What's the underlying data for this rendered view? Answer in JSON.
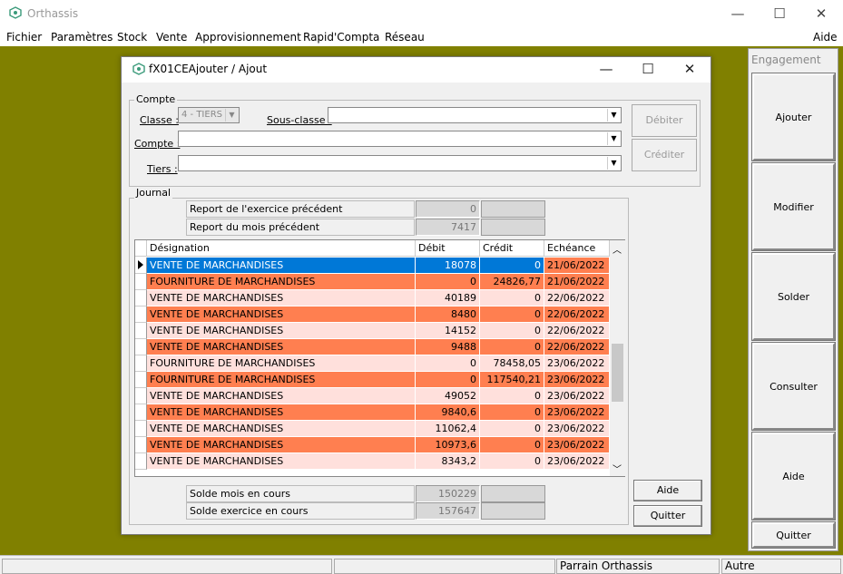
{
  "app": {
    "title": "Orthassis",
    "minimize": "—",
    "maximize": "☐",
    "close": "✕"
  },
  "menu": [
    "Fichier",
    "Paramètres",
    "Stock",
    "Vente",
    "Approvisionnement",
    "Rapid'Compta",
    "Réseau"
  ],
  "menu_help": "Aide",
  "engagement": {
    "title": "Engagement",
    "buttons": [
      "Ajouter",
      "Modifier",
      "Solder",
      "Consulter",
      "Aide",
      "Quitter"
    ]
  },
  "dialog": {
    "title": "fX01CEAjouter / Ajout",
    "compte": {
      "group": "Compte",
      "classe_label": "Classe :",
      "classe_value": "4 - TIERS",
      "sousclasse_label": "Sous-classe :",
      "compte_label": "Compte :",
      "tiers_label": "Tiers :",
      "debiter": "Débiter",
      "crediter": "Créditer"
    },
    "journal": {
      "group": "Journal",
      "report_exercice_label": "Report de l'exercice précédent",
      "report_exercice_value": "0",
      "report_mois_label": "Report du mois précédent",
      "report_mois_value": "7417",
      "columns": [
        "Désignation",
        "Débit",
        "Crédit",
        "Echéance"
      ],
      "rows": [
        [
          "VENTE DE MARCHANDISES",
          "18078",
          "0",
          "21/06/2022"
        ],
        [
          "FOURNITURE DE MARCHANDISES",
          "0",
          "24826,77",
          "21/06/2022"
        ],
        [
          "VENTE DE MARCHANDISES",
          "40189",
          "0",
          "22/06/2022"
        ],
        [
          "VENTE DE MARCHANDISES",
          "8480",
          "0",
          "22/06/2022"
        ],
        [
          "VENTE DE MARCHANDISES",
          "14152",
          "0",
          "22/06/2022"
        ],
        [
          "VENTE DE MARCHANDISES",
          "9488",
          "0",
          "22/06/2022"
        ],
        [
          "FOURNITURE DE MARCHANDISES",
          "0",
          "78458,05",
          "23/06/2022"
        ],
        [
          "FOURNITURE DE MARCHANDISES",
          "0",
          "117540,21",
          "23/06/2022"
        ],
        [
          "VENTE DE MARCHANDISES",
          "49052",
          "0",
          "23/06/2022"
        ],
        [
          "VENTE DE MARCHANDISES",
          "9840,6",
          "0",
          "23/06/2022"
        ],
        [
          "VENTE DE MARCHANDISES",
          "11062,4",
          "0",
          "23/06/2022"
        ],
        [
          "VENTE DE MARCHANDISES",
          "10973,6",
          "0",
          "23/06/2022"
        ],
        [
          "VENTE DE MARCHANDISES",
          "8343,2",
          "0",
          "23/06/2022"
        ]
      ],
      "solde_mois_label": "Solde mois en cours",
      "solde_mois_value": "150229",
      "solde_exercice_label": "Solde exercice en cours",
      "solde_exercice_value": "157647"
    },
    "aide": "Aide",
    "quitter": "Quitter"
  },
  "status": {
    "parrain": "Parrain Orthassis",
    "autre": "Autre"
  },
  "colors": {
    "selected": "#0078d7",
    "orange": "#ff7f50",
    "pink": "#ffe0dc",
    "mdi": "#808000"
  }
}
